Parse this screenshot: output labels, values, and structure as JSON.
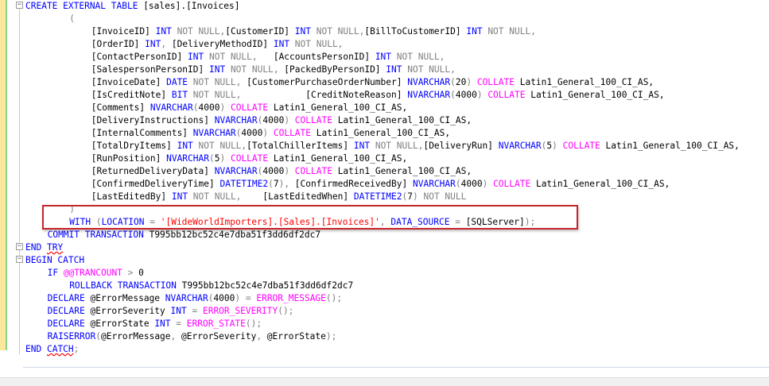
{
  "editor": {
    "lines": [
      {
        "indent": 0,
        "tokens": [
          {
            "t": "CREATE EXTERNAL TABLE",
            "c": "kw"
          },
          {
            "t": " [sales].[Invoices]",
            "c": "plain"
          }
        ]
      },
      {
        "indent": 8,
        "tokens": [
          {
            "t": "(",
            "c": "gray"
          }
        ]
      },
      {
        "indent": 12,
        "tokens": [
          {
            "t": "[InvoiceID] ",
            "c": "plain"
          },
          {
            "t": "INT",
            "c": "kw"
          },
          {
            "t": " NOT NULL",
            "c": "gray"
          },
          {
            "t": ",",
            "c": "gray"
          },
          {
            "t": "[CustomerID] ",
            "c": "plain"
          },
          {
            "t": "INT",
            "c": "kw"
          },
          {
            "t": " NOT NULL",
            "c": "gray"
          },
          {
            "t": ",",
            "c": "gray"
          },
          {
            "t": "[BillToCustomerID] ",
            "c": "plain"
          },
          {
            "t": "INT",
            "c": "kw"
          },
          {
            "t": " NOT NULL,",
            "c": "gray"
          }
        ]
      },
      {
        "indent": 12,
        "tokens": [
          {
            "t": "[OrderID] ",
            "c": "plain"
          },
          {
            "t": "INT",
            "c": "kw"
          },
          {
            "t": ", ",
            "c": "gray"
          },
          {
            "t": "[DeliveryMethodID] ",
            "c": "plain"
          },
          {
            "t": "INT",
            "c": "kw"
          },
          {
            "t": " NOT NULL,",
            "c": "gray"
          }
        ]
      },
      {
        "indent": 12,
        "tokens": [
          {
            "t": "[ContactPersonID] ",
            "c": "plain"
          },
          {
            "t": "INT",
            "c": "kw"
          },
          {
            "t": " NOT NULL,",
            "c": "gray"
          },
          {
            "t": "   [AccountsPersonID] ",
            "c": "plain"
          },
          {
            "t": "INT",
            "c": "kw"
          },
          {
            "t": " NOT NULL,",
            "c": "gray"
          }
        ]
      },
      {
        "indent": 12,
        "tokens": [
          {
            "t": "[SalespersonPersonID] ",
            "c": "plain"
          },
          {
            "t": "INT",
            "c": "kw"
          },
          {
            "t": " NOT NULL,",
            "c": "gray"
          },
          {
            "t": " [PackedByPersonID] ",
            "c": "plain"
          },
          {
            "t": "INT",
            "c": "kw"
          },
          {
            "t": " NOT NULL,",
            "c": "gray"
          }
        ]
      },
      {
        "indent": 12,
        "tokens": [
          {
            "t": "[InvoiceDate] ",
            "c": "plain"
          },
          {
            "t": "DATE",
            "c": "kw"
          },
          {
            "t": " NOT NULL,",
            "c": "gray"
          },
          {
            "t": " [CustomerPurchaseOrderNumber] ",
            "c": "plain"
          },
          {
            "t": "NVARCHAR",
            "c": "kw"
          },
          {
            "t": "(",
            "c": "gray"
          },
          {
            "t": "20",
            "c": "plain"
          },
          {
            "t": ") ",
            "c": "gray"
          },
          {
            "t": "COLLATE",
            "c": "fn"
          },
          {
            "t": " Latin1_General_100_CI_AS,",
            "c": "plain"
          }
        ]
      },
      {
        "indent": 12,
        "tokens": [
          {
            "t": "[IsCreditNote] ",
            "c": "plain"
          },
          {
            "t": "BIT",
            "c": "kw"
          },
          {
            "t": " NOT NULL,",
            "c": "gray"
          },
          {
            "t": "            [CreditNoteReason] ",
            "c": "plain"
          },
          {
            "t": "NVARCHAR",
            "c": "kw"
          },
          {
            "t": "(",
            "c": "gray"
          },
          {
            "t": "4000",
            "c": "plain"
          },
          {
            "t": ") ",
            "c": "gray"
          },
          {
            "t": "COLLATE",
            "c": "fn"
          },
          {
            "t": " Latin1_General_100_CI_AS,",
            "c": "plain"
          }
        ]
      },
      {
        "indent": 12,
        "tokens": [
          {
            "t": "[Comments] ",
            "c": "plain"
          },
          {
            "t": "NVARCHAR",
            "c": "kw"
          },
          {
            "t": "(",
            "c": "gray"
          },
          {
            "t": "4000",
            "c": "plain"
          },
          {
            "t": ") ",
            "c": "gray"
          },
          {
            "t": "COLLATE",
            "c": "fn"
          },
          {
            "t": " Latin1_General_100_CI_AS,",
            "c": "plain"
          }
        ]
      },
      {
        "indent": 12,
        "tokens": [
          {
            "t": "[DeliveryInstructions] ",
            "c": "plain"
          },
          {
            "t": "NVARCHAR",
            "c": "kw"
          },
          {
            "t": "(",
            "c": "gray"
          },
          {
            "t": "4000",
            "c": "plain"
          },
          {
            "t": ") ",
            "c": "gray"
          },
          {
            "t": "COLLATE",
            "c": "fn"
          },
          {
            "t": " Latin1_General_100_CI_AS,",
            "c": "plain"
          }
        ]
      },
      {
        "indent": 12,
        "tokens": [
          {
            "t": "[InternalComments] ",
            "c": "plain"
          },
          {
            "t": "NVARCHAR",
            "c": "kw"
          },
          {
            "t": "(",
            "c": "gray"
          },
          {
            "t": "4000",
            "c": "plain"
          },
          {
            "t": ") ",
            "c": "gray"
          },
          {
            "t": "COLLATE",
            "c": "fn"
          },
          {
            "t": " Latin1_General_100_CI_AS,",
            "c": "plain"
          }
        ]
      },
      {
        "indent": 12,
        "tokens": [
          {
            "t": "[TotalDryItems] ",
            "c": "plain"
          },
          {
            "t": "INT",
            "c": "kw"
          },
          {
            "t": " NOT NULL,",
            "c": "gray"
          },
          {
            "t": "[TotalChillerItems] ",
            "c": "plain"
          },
          {
            "t": "INT",
            "c": "kw"
          },
          {
            "t": " NOT NULL,",
            "c": "gray"
          },
          {
            "t": "[DeliveryRun] ",
            "c": "plain"
          },
          {
            "t": "NVARCHAR",
            "c": "kw"
          },
          {
            "t": "(",
            "c": "gray"
          },
          {
            "t": "5",
            "c": "plain"
          },
          {
            "t": ") ",
            "c": "gray"
          },
          {
            "t": "COLLATE",
            "c": "fn"
          },
          {
            "t": " Latin1_General_100_CI_AS,",
            "c": "plain"
          }
        ]
      },
      {
        "indent": 12,
        "tokens": [
          {
            "t": "[RunPosition] ",
            "c": "plain"
          },
          {
            "t": "NVARCHAR",
            "c": "kw"
          },
          {
            "t": "(",
            "c": "gray"
          },
          {
            "t": "5",
            "c": "plain"
          },
          {
            "t": ") ",
            "c": "gray"
          },
          {
            "t": "COLLATE",
            "c": "fn"
          },
          {
            "t": " Latin1_General_100_CI_AS,",
            "c": "plain"
          }
        ]
      },
      {
        "indent": 12,
        "tokens": [
          {
            "t": "[ReturnedDeliveryData] ",
            "c": "plain"
          },
          {
            "t": "NVARCHAR",
            "c": "kw"
          },
          {
            "t": "(",
            "c": "gray"
          },
          {
            "t": "4000",
            "c": "plain"
          },
          {
            "t": ") ",
            "c": "gray"
          },
          {
            "t": "COLLATE",
            "c": "fn"
          },
          {
            "t": " Latin1_General_100_CI_AS,",
            "c": "plain"
          }
        ]
      },
      {
        "indent": 12,
        "tokens": [
          {
            "t": "[ConfirmedDeliveryTime] ",
            "c": "plain"
          },
          {
            "t": "DATETIME2",
            "c": "kw"
          },
          {
            "t": "(",
            "c": "gray"
          },
          {
            "t": "7",
            "c": "plain"
          },
          {
            "t": "), ",
            "c": "gray"
          },
          {
            "t": "[ConfirmedReceivedBy] ",
            "c": "plain"
          },
          {
            "t": "NVARCHAR",
            "c": "kw"
          },
          {
            "t": "(",
            "c": "gray"
          },
          {
            "t": "4000",
            "c": "plain"
          },
          {
            "t": ") ",
            "c": "gray"
          },
          {
            "t": "COLLATE",
            "c": "fn"
          },
          {
            "t": " Latin1_General_100_CI_AS,",
            "c": "plain"
          }
        ]
      },
      {
        "indent": 12,
        "tokens": [
          {
            "t": "[LastEditedBy] ",
            "c": "plain"
          },
          {
            "t": "INT",
            "c": "kw"
          },
          {
            "t": " NOT NULL,",
            "c": "gray"
          },
          {
            "t": "    [LastEditedWhen] ",
            "c": "plain"
          },
          {
            "t": "DATETIME2",
            "c": "kw"
          },
          {
            "t": "(",
            "c": "gray"
          },
          {
            "t": "7",
            "c": "plain"
          },
          {
            "t": ") ",
            "c": "gray"
          },
          {
            "t": "NOT NULL",
            "c": "gray"
          }
        ]
      },
      {
        "indent": 8,
        "tokens": [
          {
            "t": ")",
            "c": "gray"
          }
        ]
      },
      {
        "indent": 8,
        "tokens": [
          {
            "t": "WITH",
            "c": "kw"
          },
          {
            "t": " (",
            "c": "gray"
          },
          {
            "t": "LOCATION",
            "c": "kw"
          },
          {
            "t": " = ",
            "c": "gray"
          },
          {
            "t": "'[WideWorldImporters].[Sales].[Invoices]'",
            "c": "str"
          },
          {
            "t": ", ",
            "c": "gray"
          },
          {
            "t": "DATA_SOURCE",
            "c": "kw"
          },
          {
            "t": " = ",
            "c": "gray"
          },
          {
            "t": "[SQLServer]",
            "c": "plain"
          },
          {
            "t": ");",
            "c": "gray"
          }
        ]
      },
      {
        "indent": 4,
        "tokens": [
          {
            "t": "COMMIT TRANSACTION",
            "c": "kw"
          },
          {
            "t": " T995bb12bc52c4e7dba51f3dd6df2dc7",
            "c": "plain"
          }
        ]
      },
      {
        "indent": 0,
        "tokens": [
          {
            "t": "END",
            "c": "kw"
          },
          {
            "t": " ",
            "c": "plain"
          },
          {
            "t": "TRY",
            "c": "kw",
            "err": true
          }
        ]
      },
      {
        "indent": 0,
        "tokens": [
          {
            "t": "BEGIN CATCH",
            "c": "kw"
          }
        ]
      },
      {
        "indent": 4,
        "tokens": [
          {
            "t": "IF",
            "c": "kw"
          },
          {
            "t": " ",
            "c": "plain"
          },
          {
            "t": "@@TRANCOUNT",
            "c": "fn"
          },
          {
            "t": " > ",
            "c": "gray"
          },
          {
            "t": "0",
            "c": "plain"
          }
        ]
      },
      {
        "indent": 8,
        "tokens": [
          {
            "t": "ROLLBACK TRANSACTION",
            "c": "kw"
          },
          {
            "t": " T995bb12bc52c4e7dba51f3dd6df2dc7",
            "c": "plain"
          }
        ]
      },
      {
        "indent": 4,
        "tokens": [
          {
            "t": "DECLARE",
            "c": "kw"
          },
          {
            "t": " @ErrorMessage ",
            "c": "plain"
          },
          {
            "t": "NVARCHAR",
            "c": "kw"
          },
          {
            "t": "(",
            "c": "gray"
          },
          {
            "t": "4000",
            "c": "plain"
          },
          {
            "t": ") = ",
            "c": "gray"
          },
          {
            "t": "ERROR_MESSAGE",
            "c": "fn"
          },
          {
            "t": "();",
            "c": "gray"
          }
        ]
      },
      {
        "indent": 4,
        "tokens": [
          {
            "t": "DECLARE",
            "c": "kw"
          },
          {
            "t": " @ErrorSeverity ",
            "c": "plain"
          },
          {
            "t": "INT",
            "c": "kw"
          },
          {
            "t": " = ",
            "c": "gray"
          },
          {
            "t": "ERROR_SEVERITY",
            "c": "fn"
          },
          {
            "t": "();",
            "c": "gray"
          }
        ]
      },
      {
        "indent": 4,
        "tokens": [
          {
            "t": "DECLARE",
            "c": "kw"
          },
          {
            "t": " @ErrorState ",
            "c": "plain"
          },
          {
            "t": "INT",
            "c": "kw"
          },
          {
            "t": " = ",
            "c": "gray"
          },
          {
            "t": "ERROR_STATE",
            "c": "fn"
          },
          {
            "t": "();",
            "c": "gray"
          }
        ]
      },
      {
        "indent": 4,
        "tokens": [
          {
            "t": "RAISERROR",
            "c": "kw"
          },
          {
            "t": "(",
            "c": "gray"
          },
          {
            "t": "@ErrorMessage",
            "c": "plain"
          },
          {
            "t": ", ",
            "c": "gray"
          },
          {
            "t": "@ErrorSeverity",
            "c": "plain"
          },
          {
            "t": ", ",
            "c": "gray"
          },
          {
            "t": "@ErrorState",
            "c": "plain"
          },
          {
            "t": ");",
            "c": "gray"
          }
        ]
      },
      {
        "indent": 0,
        "tokens": [
          {
            "t": "END",
            "c": "kw"
          },
          {
            "t": " ",
            "c": "plain"
          },
          {
            "t": "CATCH",
            "c": "kw",
            "err": true
          },
          {
            "t": ";",
            "c": "gray"
          }
        ]
      }
    ],
    "fold_markers": [
      "−",
      "−",
      "−"
    ]
  }
}
